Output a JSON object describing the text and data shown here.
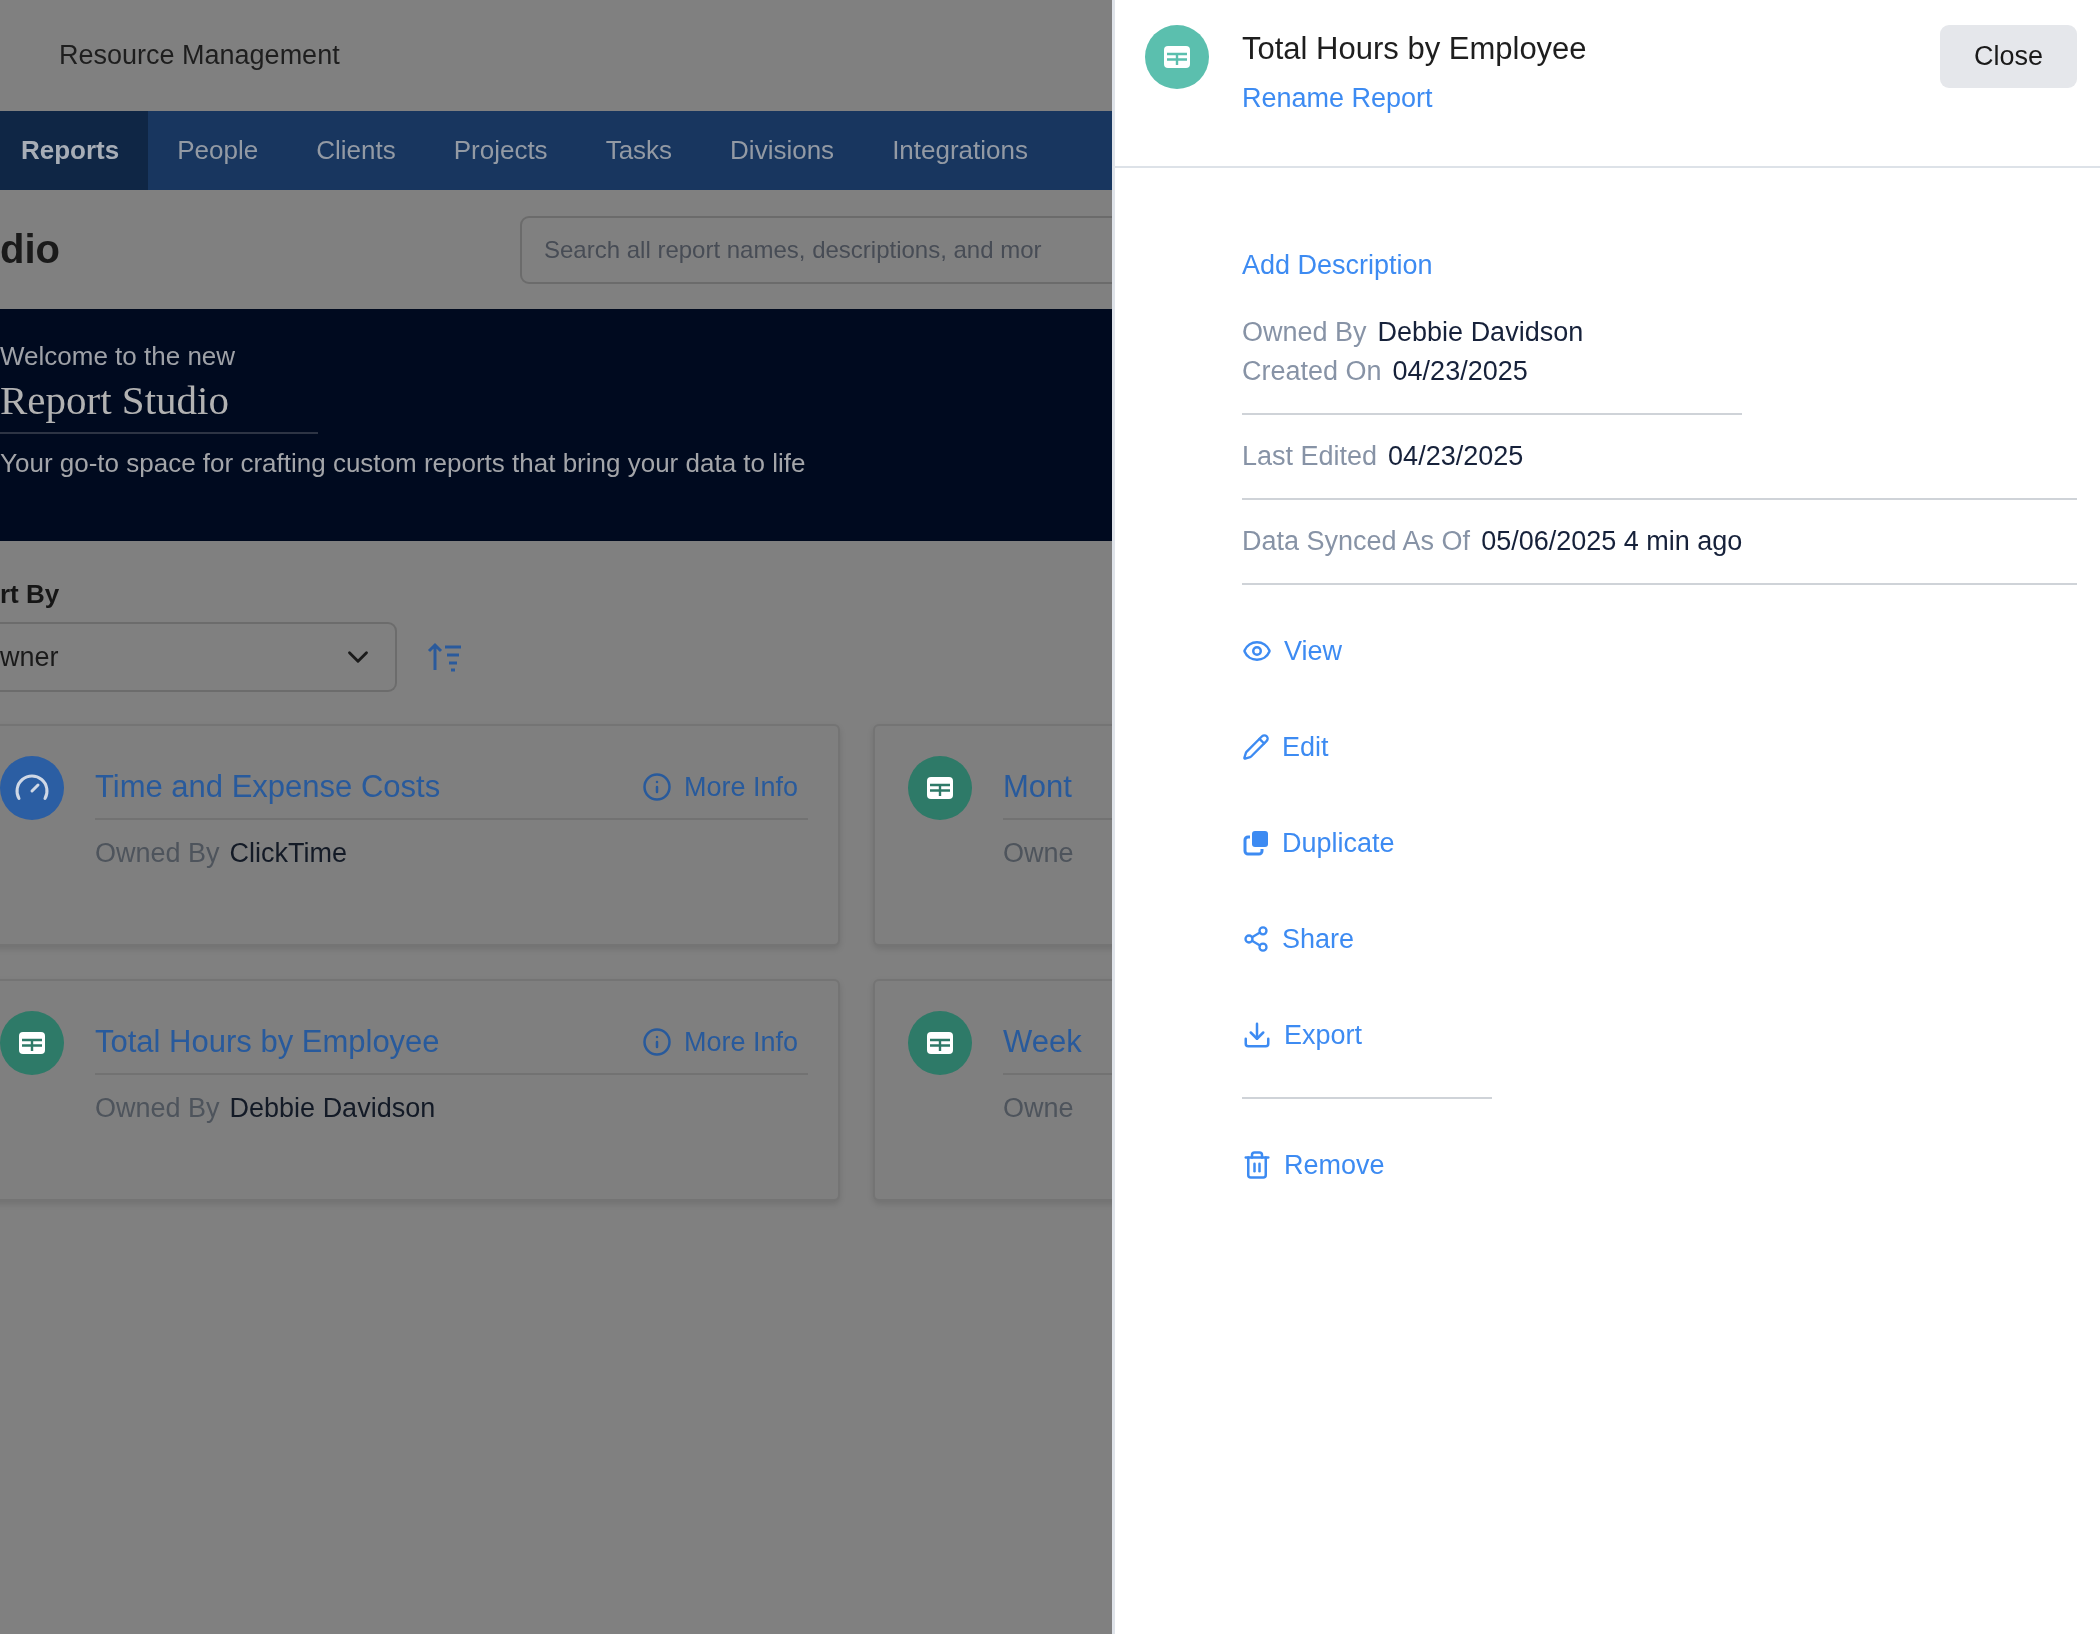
{
  "app": {
    "title": "Resource Management"
  },
  "nav": [
    {
      "label": "Reports",
      "selected": true
    },
    {
      "label": "People",
      "selected": false
    },
    {
      "label": "Clients",
      "selected": false
    },
    {
      "label": "Projects",
      "selected": false
    },
    {
      "label": "Tasks",
      "selected": false
    },
    {
      "label": "Divisions",
      "selected": false
    },
    {
      "label": "Integrations",
      "selected": false
    }
  ],
  "page": {
    "title": "dio",
    "search": {
      "placeholder": "Search all report names, descriptions, and mor"
    }
  },
  "banner": {
    "eyebrow": "Welcome to the new",
    "title": "Report Studio",
    "subtitle": "Your go-to space for crafting custom reports that bring your data to life"
  },
  "sort": {
    "label": "rt By",
    "value": "wner"
  },
  "cards": [
    {
      "kind": "gauge",
      "title": "Time and Expense Costs",
      "more_info": "More Info",
      "owner_label": "Owned By",
      "owner": "ClickTime"
    },
    {
      "kind": "table",
      "title": "Mont",
      "owner_label": "Owne"
    },
    {
      "kind": "table",
      "title": "Total Hours by Employee",
      "more_info": "More Info",
      "owner_label": "Owned By",
      "owner": "Debbie Davidson"
    },
    {
      "kind": "table",
      "title": "Week",
      "owner_label": "Owne"
    }
  ],
  "panel": {
    "title": "Total Hours by Employee",
    "rename": "Rename Report",
    "close": "Close",
    "add_description": "Add Description",
    "detail_groups": [
      {
        "rows": [
          {
            "label": "Owned By",
            "value": "Debbie Davidson"
          },
          {
            "label": "Created On",
            "value": "04/23/2025"
          }
        ]
      },
      {
        "rows": [
          {
            "label": "Last Edited",
            "value": "04/23/2025"
          }
        ]
      },
      {
        "rows": [
          {
            "label": "Data Synced As Of",
            "value": "05/06/2025 4 min ago"
          }
        ]
      }
    ],
    "actions": [
      {
        "kind": "view",
        "label": "View"
      },
      {
        "kind": "edit",
        "label": "Edit"
      },
      {
        "kind": "duplicate",
        "label": "Duplicate"
      },
      {
        "kind": "share",
        "label": "Share"
      },
      {
        "kind": "export",
        "label": "Export"
      },
      {
        "kind": "remove",
        "label": "Remove"
      }
    ]
  }
}
